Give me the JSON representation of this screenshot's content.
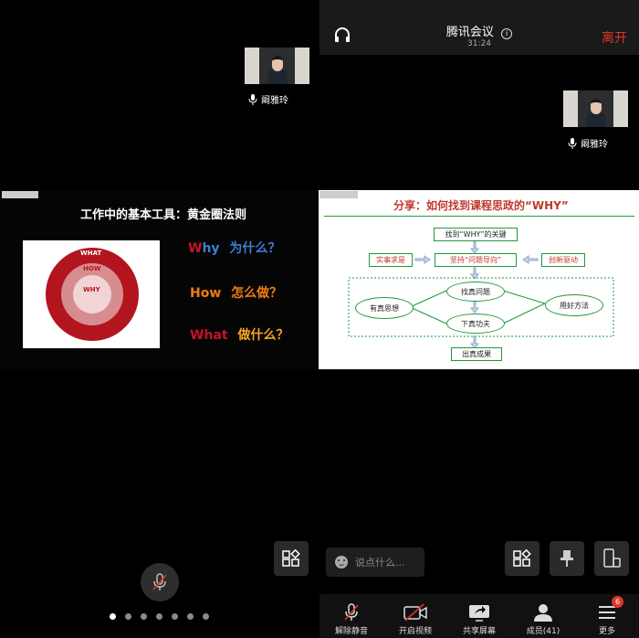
{
  "header": {
    "title": "腾讯会议",
    "timer": "31:24",
    "leave_label": "离开"
  },
  "participants": [
    {
      "name": "阚雅玲"
    },
    {
      "name": "阚雅玲"
    }
  ],
  "slide_left": {
    "title": "工作中的基本工具：黄金圈法则",
    "rings": [
      "WHAT",
      "HOW",
      "WHY"
    ],
    "questions": [
      {
        "first": "W",
        "rest": "hy",
        "zh": "为什么？",
        "color": "#3d7fd0"
      },
      {
        "first": "H",
        "rest": "ow",
        "zh": "怎么做？",
        "color": "#f07d11"
      },
      {
        "first": "W",
        "rest": "hat",
        "zh": "做什么？",
        "color": "#f5a623"
      }
    ],
    "accent_red": "#c8102e"
  },
  "slide_right": {
    "title": "分享：如何找到课程思政的“WHY”",
    "boxes": {
      "key": "找到“WHY”的关键",
      "left": "实事求是",
      "center": "坚持“问题导向”",
      "right": "创新驱动",
      "find": "找真问题",
      "think": "有真思想",
      "method": "用好方法",
      "effort": "下真功夫",
      "result": "出真成果"
    }
  },
  "chat": {
    "placeholder": "说点什么..."
  },
  "page_dots": {
    "count": 7,
    "active": 0
  },
  "toolbar": {
    "unmute": "解除静音",
    "video": "开启视频",
    "share": "共享屏幕",
    "members": "成员(41)",
    "more": "更多",
    "more_badge": "6"
  }
}
